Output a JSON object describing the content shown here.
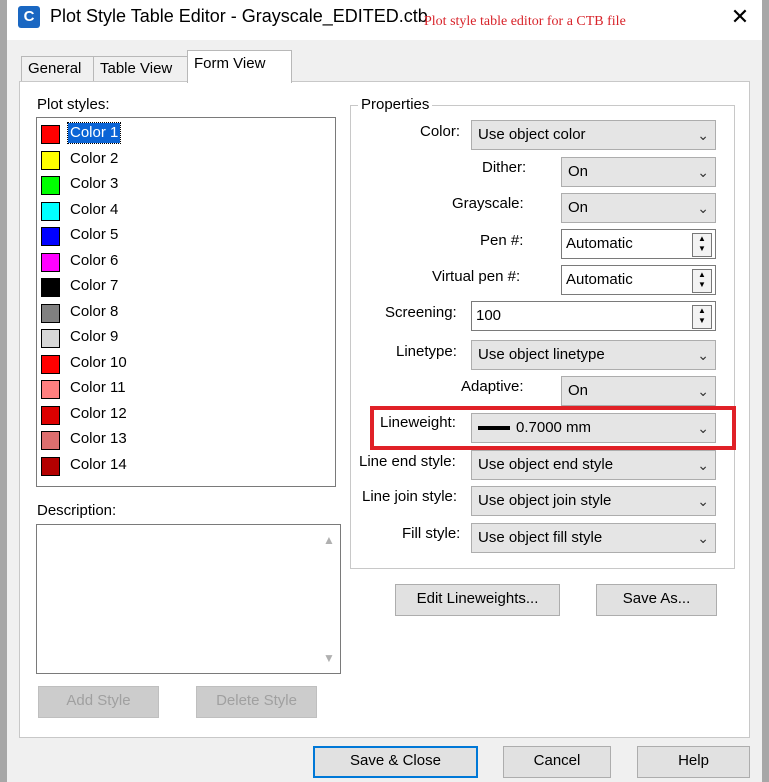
{
  "window": {
    "title": "Plot Style Table Editor - Grayscale_EDITED.ctb",
    "annotation": "Plot style table editor for a CTB file",
    "app_icon_letter": "C",
    "close_glyph": "✕"
  },
  "tabs": [
    {
      "label": "General"
    },
    {
      "label": "Table View"
    },
    {
      "label": "Form View"
    }
  ],
  "plot_styles": {
    "label": "Plot styles:",
    "items": [
      {
        "label": "Color 1",
        "color": "#ff0000"
      },
      {
        "label": "Color 2",
        "color": "#ffff00"
      },
      {
        "label": "Color 3",
        "color": "#00ff00"
      },
      {
        "label": "Color 4",
        "color": "#00ffff"
      },
      {
        "label": "Color 5",
        "color": "#0000ff"
      },
      {
        "label": "Color 6",
        "color": "#ff00ff"
      },
      {
        "label": "Color 7",
        "color": "#000000"
      },
      {
        "label": "Color 8",
        "color": "#808080"
      },
      {
        "label": "Color 9",
        "color": "#d7d7d7"
      },
      {
        "label": "Color 10",
        "color": "#ff0000"
      },
      {
        "label": "Color 11",
        "color": "#ff7f7f"
      },
      {
        "label": "Color 12",
        "color": "#dd0000"
      },
      {
        "label": "Color 13",
        "color": "#dd6e6e"
      },
      {
        "label": "Color 14",
        "color": "#b30000"
      }
    ],
    "selected": "Color 1"
  },
  "description": {
    "label": "Description:"
  },
  "buttons": {
    "add_style": "Add Style",
    "delete_style": "Delete Style",
    "edit_lineweights": "Edit Lineweights...",
    "save_as": "Save As...",
    "save_close": "Save & Close",
    "cancel": "Cancel",
    "help": "Help"
  },
  "properties": {
    "legend": "Properties",
    "color": {
      "label": "Color:",
      "value": "Use object color"
    },
    "dither": {
      "label": "Dither:",
      "value": "On"
    },
    "grayscale": {
      "label": "Grayscale:",
      "value": "On"
    },
    "pen": {
      "label": "Pen #:",
      "value": "Automatic"
    },
    "virtual_pen": {
      "label": "Virtual pen #:",
      "value": "Automatic"
    },
    "screening": {
      "label": "Screening:",
      "value": "100"
    },
    "linetype": {
      "label": "Linetype:",
      "value": "Use object linetype"
    },
    "adaptive": {
      "label": "Adaptive:",
      "value": "On"
    },
    "lineweight": {
      "label": "Lineweight:",
      "value": "0.7000 mm"
    },
    "line_end": {
      "label": "Line end style:",
      "value": "Use object end style"
    },
    "line_join": {
      "label": "Line join style:",
      "value": "Use object join style"
    },
    "fill": {
      "label": "Fill style:",
      "value": "Use object fill style"
    }
  },
  "colors": {
    "highlight": "#e02127",
    "selection": "#0a64d6",
    "annotation": "#d8232a",
    "accent_button_border": "#0078d7"
  }
}
